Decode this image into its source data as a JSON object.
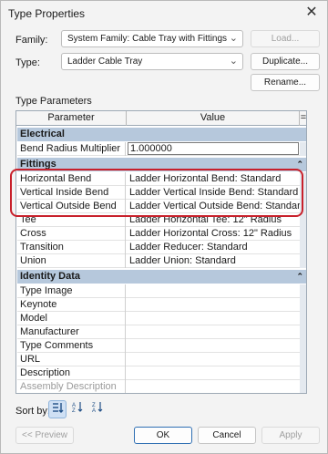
{
  "window": {
    "title": "Type Properties",
    "close_glyph": "✕"
  },
  "family": {
    "label": "Family:",
    "value": "System Family: Cable Tray with Fittings",
    "load_button": "Load..."
  },
  "type": {
    "label": "Type:",
    "value": "Ladder Cable Tray",
    "duplicate_button": "Duplicate...",
    "rename_button": "Rename..."
  },
  "type_parameters": {
    "section_label": "Type Parameters",
    "columns": [
      "Parameter",
      "Value",
      "="
    ],
    "groups": [
      {
        "name": "Electrical",
        "rows": [
          {
            "param": "Bend Radius Multiplier",
            "value": "1.000000"
          }
        ]
      },
      {
        "name": "Fittings",
        "rows": [
          {
            "param": "Horizontal Bend",
            "value": "Ladder Horizontal Bend: Standard"
          },
          {
            "param": "Vertical Inside Bend",
            "value": "Ladder Vertical Inside Bend: Standard"
          },
          {
            "param": "Vertical Outside Bend",
            "value": "Ladder Vertical Outside Bend: Standard"
          },
          {
            "param": "Tee",
            "value": "Ladder Horizontal Tee: 12\" Radius"
          },
          {
            "param": "Cross",
            "value": "Ladder Horizontal Cross: 12\" Radius"
          },
          {
            "param": "Transition",
            "value": "Ladder Reducer: Standard"
          },
          {
            "param": "Union",
            "value": "Ladder Union: Standard"
          }
        ]
      },
      {
        "name": "Identity Data",
        "rows": [
          {
            "param": "Type Image",
            "value": ""
          },
          {
            "param": "Keynote",
            "value": ""
          },
          {
            "param": "Model",
            "value": ""
          },
          {
            "param": "Manufacturer",
            "value": ""
          },
          {
            "param": "Type Comments",
            "value": ""
          },
          {
            "param": "URL",
            "value": ""
          },
          {
            "param": "Description",
            "value": ""
          },
          {
            "param": "Assembly Description",
            "value": ""
          }
        ]
      }
    ]
  },
  "sort": {
    "label": "Sort by:"
  },
  "footer": {
    "preview": "<< Preview",
    "ok": "OK",
    "cancel": "Cancel",
    "apply": "Apply"
  },
  "colors": {
    "accent": "#c8202b",
    "group_bg": "#b6c8dc"
  }
}
